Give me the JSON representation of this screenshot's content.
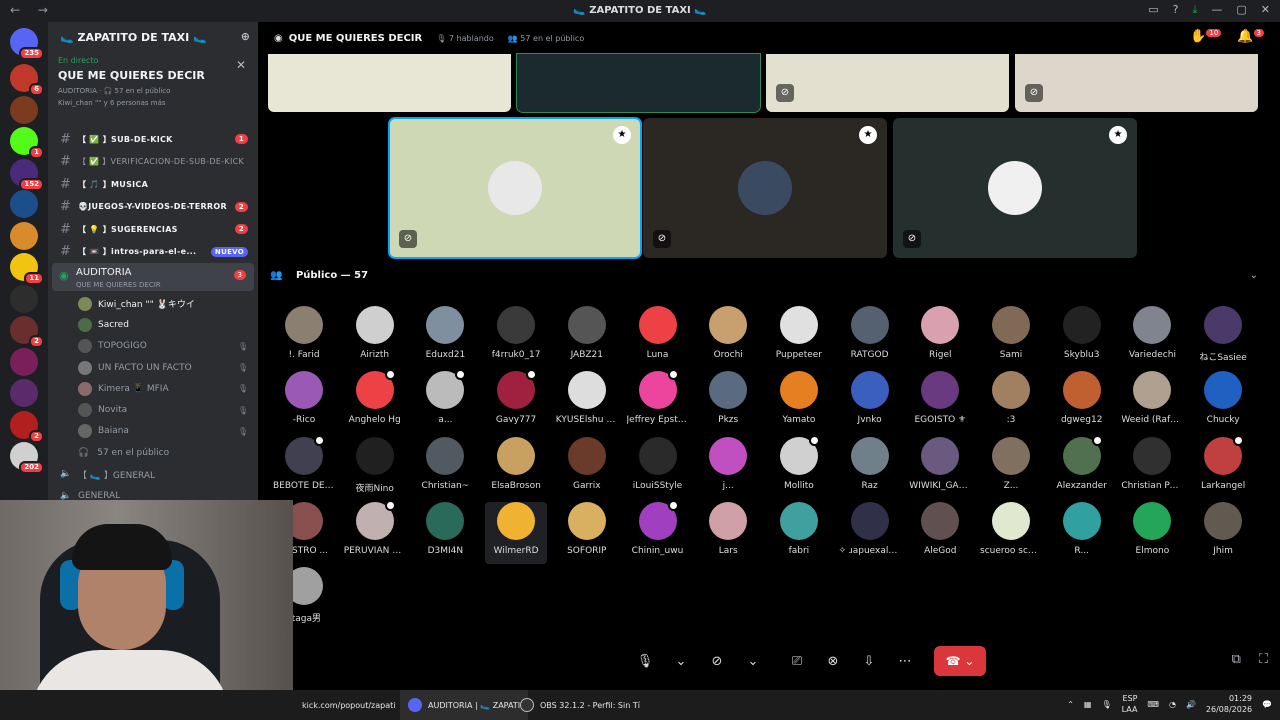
{
  "window": {
    "title": "🥿 ZAPATITO DE TAXI 🥿"
  },
  "servers": {
    "home_badge": "235",
    "items": [
      {
        "color": "#c0392b",
        "badge": "6"
      },
      {
        "color": "#7a3b1e",
        "badge": ""
      },
      {
        "color": "#53fc18",
        "badge": "1"
      },
      {
        "color": "#4a2a7a",
        "badge": "152"
      },
      {
        "color": "#1c4e8c",
        "badge": ""
      },
      {
        "color": "#d98b2b",
        "badge": ""
      },
      {
        "color": "#f1c40f",
        "badge": "11"
      },
      {
        "color": "#2d2d2d",
        "badge": ""
      },
      {
        "color": "#6b2e2e",
        "badge": "2"
      },
      {
        "color": "#7a1f5a",
        "badge": ""
      },
      {
        "color": "#5b2a6b",
        "badge": ""
      },
      {
        "color": "#b31f1f",
        "badge": "2"
      },
      {
        "color": "#d0d0d0",
        "badge": "202"
      }
    ]
  },
  "guild": {
    "name": "🥿 ZAPATITO DE TAXI 🥿"
  },
  "live": {
    "tag": "En directo",
    "title": "QUE ME QUIERES DECIR",
    "meta": "AUDITORIA · 🎧 57 en el público",
    "people": "Kiwi_chan \"\" y 6 personas más"
  },
  "channels": [
    {
      "label": "【 ✅ 】SUB-DE-KICK",
      "count": "1",
      "new": "",
      "dim": false
    },
    {
      "label": "【 ✅ 】VERIFICACION-DE-SUB-DE-KICK",
      "count": "",
      "new": "",
      "dim": true
    },
    {
      "label": "【 🎵 】MUSICA",
      "count": "",
      "new": "",
      "dim": false
    },
    {
      "label": "💀JUEGOS-Y-VIDEOS-DE-TERROR",
      "count": "2",
      "new": "",
      "dim": false
    },
    {
      "label": "【 💡 】SUGERENCIAS",
      "count": "2",
      "new": "",
      "dim": false
    },
    {
      "label": "【 📼 】intros-para-el-e...",
      "count": "",
      "new": "NUEVO",
      "dim": false
    }
  ],
  "stage_channel": {
    "name": "AUDITORIA",
    "sub": "QUE ME QUIERES DECIR",
    "count": "3"
  },
  "members": [
    {
      "name": "Kiwi_chan \"\" 🐰キウイ",
      "speaker": true,
      "mic": "",
      "color": "#7c8a5a"
    },
    {
      "name": "Sacred",
      "speaker": true,
      "mic": "",
      "color": "#4b6b4a"
    },
    {
      "name": "TOPOGIGO",
      "speaker": false,
      "mic": "🎙",
      "color": "#555"
    },
    {
      "name": "UN FACTO UN FACTO",
      "speaker": false,
      "mic": "🎙",
      "color": "#777"
    },
    {
      "name": "Kimera 📱 MFIA",
      "speaker": false,
      "mic": "🎙",
      "color": "#8a6a6a"
    },
    {
      "name": "Novita",
      "speaker": false,
      "mic": "🎙",
      "color": "#555"
    },
    {
      "name": "Baiana",
      "speaker": false,
      "mic": "🎙",
      "color": "#666"
    }
  ],
  "members_footer": "57 en el público",
  "voice_channels": [
    {
      "label": "【 🥿 】GENERAL"
    },
    {
      "label": "GENERAL"
    }
  ],
  "stage_header": {
    "title": "QUE ME QUIERES DECIR",
    "speaking": "7 hablando",
    "audience": "57 en el público",
    "hands": "10",
    "inbox": "3"
  },
  "audience_header": "Público — 57",
  "audience": [
    {
      "name": "!. Farid",
      "color": "#8a7f70",
      "hand": false
    },
    {
      "name": "Airizth",
      "color": "#cfcfcf",
      "hand": false
    },
    {
      "name": "Eduxd21",
      "color": "#7f8fa0",
      "hand": false
    },
    {
      "name": "f4rruk0_17",
      "color": "#3a3a3a",
      "hand": false
    },
    {
      "name": "JABZ21",
      "color": "#555",
      "hand": false
    },
    {
      "name": "Luna",
      "color": "#ed4245",
      "hand": false
    },
    {
      "name": "Orochi",
      "color": "#c8a070",
      "hand": false
    },
    {
      "name": "Puppeteer",
      "color": "#e0e0e0",
      "hand": false
    },
    {
      "name": "RATGOD",
      "color": "#556070",
      "hand": false
    },
    {
      "name": "Rigel",
      "color": "#d9a0b0",
      "hand": false
    },
    {
      "name": "Sami",
      "color": "#806a55",
      "hand": false
    },
    {
      "name": "Skyblu3",
      "color": "#222",
      "hand": false
    },
    {
      "name": "Variedechi",
      "color": "#80848e",
      "hand": false
    },
    {
      "name": "ねこSasiee",
      "color": "#4a3a6a",
      "hand": false
    },
    {
      "name": "-Rico",
      "color": "#9b59b6",
      "hand": false
    },
    {
      "name": "Anghelo Hg",
      "color": "#ed4245",
      "hand": true
    },
    {
      "name": "a...",
      "color": "#bbb",
      "hand": true
    },
    {
      "name": "Gavy777",
      "color": "#a02040",
      "hand": true
    },
    {
      "name": "KYUSElshu [~...",
      "color": "#ddd",
      "hand": false
    },
    {
      "name": "Jeffrey Epstein",
      "color": "#eb459e",
      "hand": true
    },
    {
      "name": "Pkzs",
      "color": "#5a6a80",
      "hand": false
    },
    {
      "name": "Yamato",
      "color": "#e67e22",
      "hand": false
    },
    {
      "name": "Jvnko",
      "color": "#3a5fbf",
      "hand": false
    },
    {
      "name": "EGOISTO ⚜",
      "color": "#6a3a80",
      "hand": false
    },
    {
      "name": ":3",
      "color": "#a08060",
      "hand": false
    },
    {
      "name": "dgweg12",
      "color": "#c06030",
      "hand": false
    },
    {
      "name": "Weeid (Rafael)",
      "color": "#b0a090",
      "hand": false
    },
    {
      "name": "Chucky",
      "color": "#2060c0",
      "hand": false
    },
    {
      "name": "BEBOTE DE S...",
      "color": "#404050",
      "hand": true
    },
    {
      "name": "夜雨Nino",
      "color": "#202020",
      "hand": false
    },
    {
      "name": "Christian~",
      "color": "#505a60",
      "hand": false
    },
    {
      "name": "ElsaBroson",
      "color": "#c8a060",
      "hand": false
    },
    {
      "name": "Garrix",
      "color": "#6a3a2a",
      "hand": false
    },
    {
      "name": "iLouiSStyle",
      "color": "#2a2a2a",
      "hand": false
    },
    {
      "name": "j...",
      "color": "#c050c0",
      "hand": false
    },
    {
      "name": "Mollito",
      "color": "#d0d0d0",
      "hand": true
    },
    {
      "name": "Raz",
      "color": "#70808a",
      "hand": false
    },
    {
      "name": "WIWIKI_GAMI...",
      "color": "#6a5a80",
      "hand": false
    },
    {
      "name": "Z...",
      "color": "#807060",
      "hand": false
    },
    {
      "name": "Alexzander",
      "color": "#507050",
      "hand": true
    },
    {
      "name": "Christian Pén...",
      "color": "#303030",
      "hand": false
    },
    {
      "name": "Larkangel",
      "color": "#c04040",
      "hand": true
    },
    {
      "name": "RASTRO ...",
      "color": "#8a5050",
      "hand": false
    },
    {
      "name": "PERUVIAN H...",
      "color": "#c0b0b0",
      "hand": true
    },
    {
      "name": "D3MI4N",
      "color": "#2a6a5a",
      "hand": false
    },
    {
      "name": "WilmerRD",
      "color": "#f0b232",
      "hand": false
    },
    {
      "name": "SOFORIP",
      "color": "#d8b060",
      "hand": false
    },
    {
      "name": "Chinin_uwu",
      "color": "#a040c0",
      "hand": true
    },
    {
      "name": "Lars",
      "color": "#d0a0a8",
      "hand": false
    },
    {
      "name": "fabri",
      "color": "#40a0a0",
      "hand": false
    },
    {
      "name": "✧ ɹapuexale ✧",
      "color": "#303048",
      "hand": false
    },
    {
      "name": "AleGod",
      "color": "#605050",
      "hand": false
    },
    {
      "name": "scueroo scuer...",
      "color": "#e0e8d0",
      "hand": false
    },
    {
      "name": "R...",
      "color": "#30a0a0",
      "hand": false
    },
    {
      "name": "Elmono",
      "color": "#23a55a",
      "hand": false
    },
    {
      "name": "Jhim",
      "color": "#605a50",
      "hand": false
    },
    {
      "name": "staga男",
      "color": "#a0a0a0",
      "hand": false
    }
  ],
  "tiles_top": [
    {
      "bg": "#e8e7d6",
      "sel": false
    },
    {
      "bg": "#1a2a2e",
      "sel": false
    },
    {
      "bg": "#e3e0cf",
      "sel": false
    },
    {
      "bg": "#ddd7cb",
      "sel": false
    }
  ],
  "tiles_speakers": [
    {
      "bg": "#cfd8b4",
      "avatar": "#e8e8e8",
      "sel": true
    },
    {
      "bg": "#2b2723",
      "avatar": "#3a4a60",
      "sel": false
    },
    {
      "bg": "#25302e",
      "avatar": "#f0f0f0",
      "sel": false
    }
  ],
  "taskbar": {
    "item1": "kick.com/popout/zapati",
    "item2": "AUDITORIA | 🥿 ZAPATI",
    "item3": "OBS 32.1.2 - Perfil: Sin Tí",
    "lang1": "ESP",
    "lang2": "LAA",
    "time": "01:29",
    "date": "26/08/2026"
  }
}
